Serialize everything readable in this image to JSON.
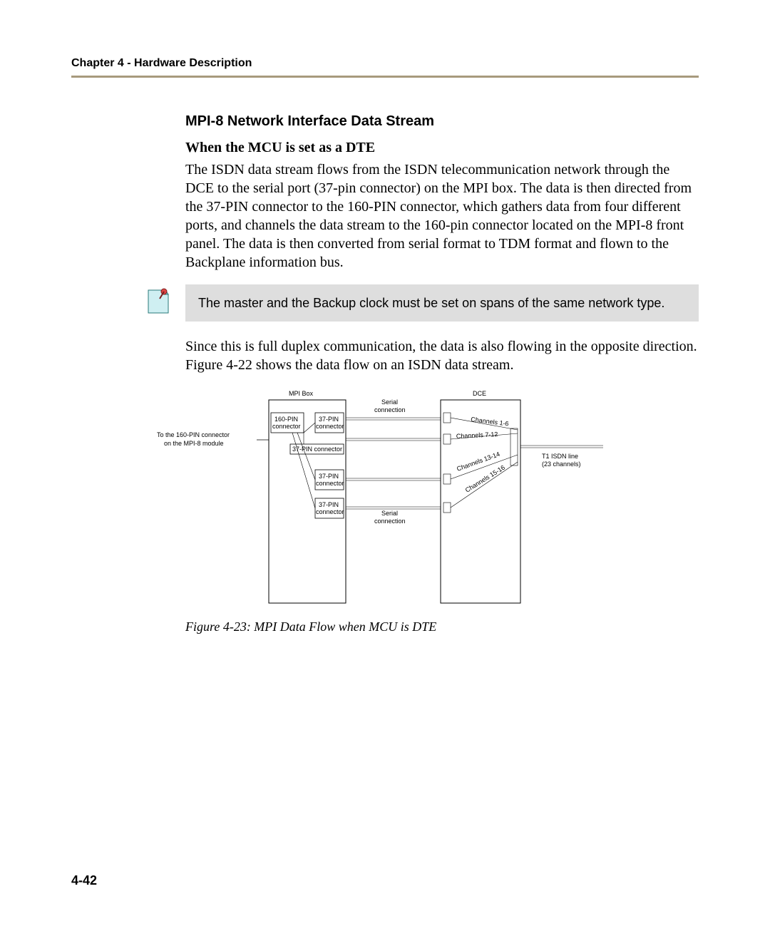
{
  "chapter_header": "Chapter 4 - Hardware Description",
  "section_title": "MPI-8 Network Interface Data Stream",
  "sub_title": "When the MCU is set as a DTE",
  "paragraph1": "The ISDN data stream flows from the ISDN telecommunication network through the DCE to the serial port (37-pin connector) on the MPI box. The data is then directed from the 37-PIN connector to the 160-PIN connector, which gathers data from four different ports, and channels the data stream to the 160-pin connector located on the MPI-8 front panel. The data is then converted from serial format to TDM format and flown to the Backplane information bus.",
  "note_text": "The master and the Backup clock must be set on spans of the same network type.",
  "paragraph2": "Since this is full duplex communication, the data is also flowing in the opposite direction. Figure 4-22 shows the data flow on an ISDN data stream.",
  "diagram": {
    "label_left_1": "To the 160-PIN connector",
    "label_left_2": "on the MPI-8 module",
    "mpi_box_title": "MPI Box",
    "dce_title": "DCE",
    "connector_160": "160-PIN",
    "connector_160b": "connector",
    "connector_37a": "37-PIN",
    "connector_37b": "connector",
    "connector_37c": "37-PIN connector",
    "serial_top": "Serial",
    "serial_top2": "connection",
    "serial_bot": "Serial",
    "serial_bot2": "connection",
    "ch16": "Channels 1-6",
    "ch712": "Channels 7-12",
    "ch1314": "Channels 13-14",
    "ch1516": "Channels 15-16",
    "t1_line1": "T1 ISDN line",
    "t1_line2": "(23 channels)"
  },
  "figure_caption": "Figure 4-23: MPI Data Flow when MCU is DTE",
  "page_number": "4-42"
}
